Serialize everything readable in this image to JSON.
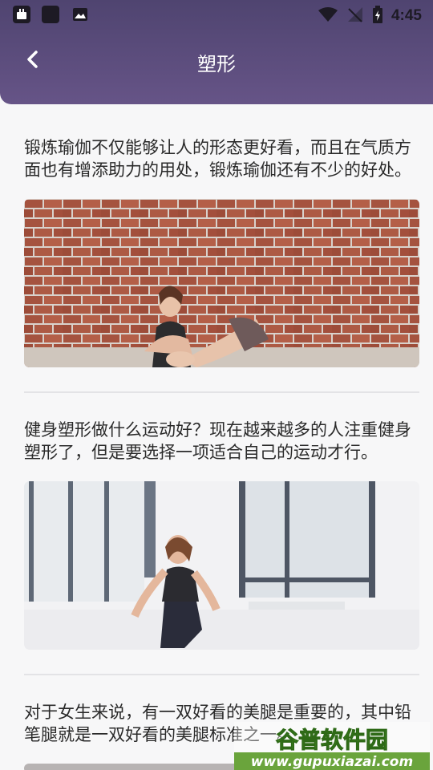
{
  "statusbar": {
    "time": "4:45"
  },
  "header": {
    "title": "塑形"
  },
  "articles": [
    {
      "text": "锻炼瑜伽不仅能够让人的形态更好看，而且在气质方面也有增添助力的用处，锻炼瑜伽还有不少的好处。"
    },
    {
      "text": "健身塑形做什么运动好？现在越来越多的人注重健身塑形了，但是要选择一项适合自己的运动才行。"
    },
    {
      "text": "对于女生来说，有一双好看的美腿是重要的，其中铅笔腿就是一双好看的美腿标准之一。"
    }
  ],
  "watermark": {
    "brand": "谷普软件园",
    "url": "www.gupuxiazai.com"
  }
}
